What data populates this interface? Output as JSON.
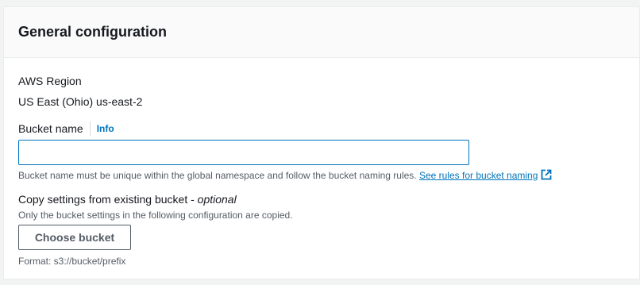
{
  "panel": {
    "title": "General configuration"
  },
  "region": {
    "label": "AWS Region",
    "value": "US East (Ohio) us-east-2"
  },
  "bucket_name": {
    "label": "Bucket name",
    "info_link": "Info",
    "input_value": "",
    "hint_text": "Bucket name must be unique within the global namespace and follow the bucket naming rules.",
    "rules_link": "See rules for bucket naming",
    "rules_icon": "external-link-icon"
  },
  "copy_settings": {
    "label": "Copy settings from existing bucket - ",
    "optional": "optional",
    "description": "Only the bucket settings in the following configuration are copied.",
    "button_label": "Choose bucket",
    "format_text": "Format: s3://bucket/prefix"
  },
  "colors": {
    "link": "#0073bb",
    "input_focus_border": "#0073bb",
    "text": "#16191f",
    "secondary_text": "#545b64",
    "header_bg": "#fafafa"
  }
}
